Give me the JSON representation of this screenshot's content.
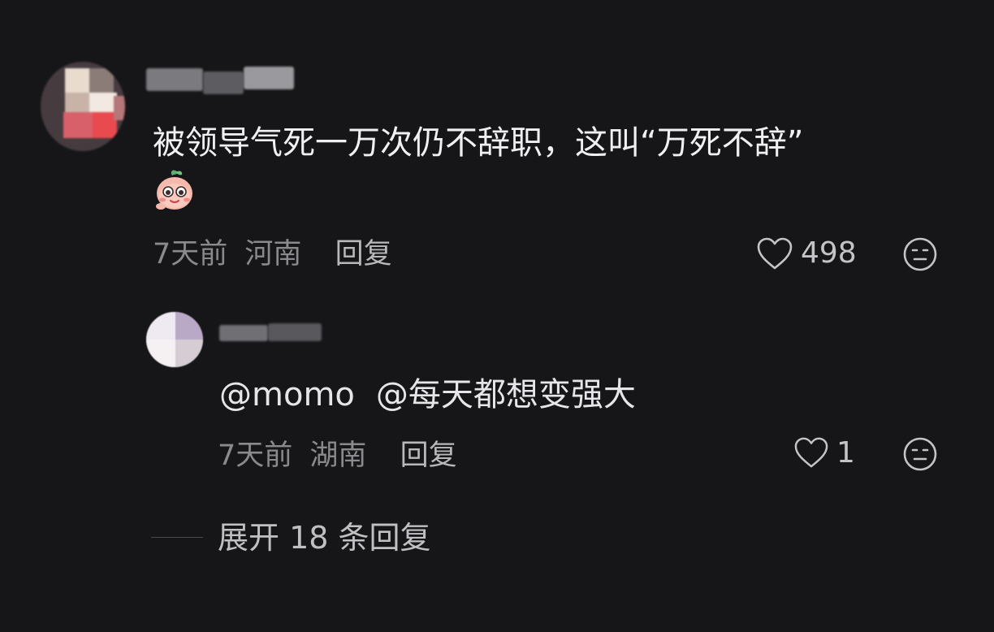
{
  "comment": {
    "text": "被领导气死一万次仍不辞职，这叫“万死不辞”",
    "emoji_icon": "peach-face-emoji",
    "time": "7天前",
    "location": "河南",
    "reply_label": "回复",
    "like_count": "498"
  },
  "reply": {
    "mention1": "@momo",
    "mention2": "@每天都想变强大",
    "time": "7天前",
    "location": "湖南",
    "reply_label": "回复",
    "like_count": "1"
  },
  "expand": {
    "label": "展开 18 条回复"
  },
  "icons": {
    "like": "heart-outline-icon",
    "dislike": "neutral-face-icon"
  },
  "colors": {
    "background": "#161618",
    "text": "#f0f0f2",
    "meta": "#8a8a8e"
  }
}
